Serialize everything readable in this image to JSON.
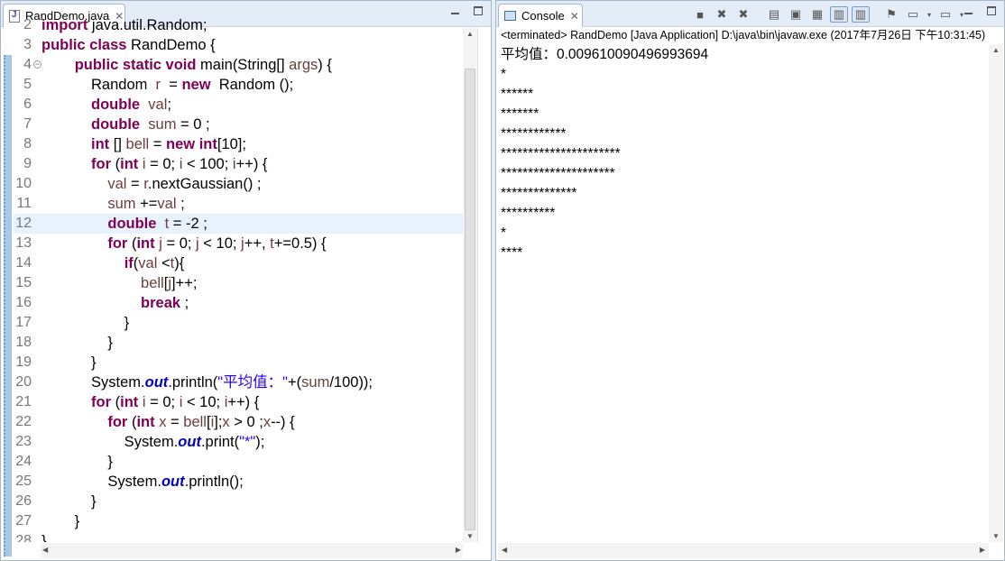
{
  "editor": {
    "tab_title": "RandDemo.java",
    "close_glyph": "✕",
    "lines": [
      {
        "n": "2",
        "html": "<span class=\"kw\">import</span> java.util.Random;"
      },
      {
        "n": "3",
        "html": "<span class=\"kw\">public class</span> RandDemo {"
      },
      {
        "n": "4",
        "html": "        <span class=\"kw\">public static void</span> main(String[] <span class=\"var\">args</span>) {",
        "fold": true
      },
      {
        "n": "5",
        "html": "            Random  <span class=\"var\">r</span>  = <span class=\"kw\">new</span>  Random ();"
      },
      {
        "n": "6",
        "html": "            <span class=\"kw\">double</span>  <span class=\"var\">val</span>;"
      },
      {
        "n": "7",
        "html": "            <span class=\"kw\">double</span>  <span class=\"var\">sum</span> = 0 ;"
      },
      {
        "n": "8",
        "html": "            <span class=\"kw\">int</span> [] <span class=\"var\">bell</span> = <span class=\"kw\">new int</span>[10];"
      },
      {
        "n": "9",
        "html": "            <span class=\"kw\">for</span> (<span class=\"kw\">int</span> <span class=\"var\">i</span> = 0; <span class=\"var\">i</span> &lt; 100; <span class=\"var\">i</span>++) {"
      },
      {
        "n": "10",
        "html": "                <span class=\"var\">val</span> = <span class=\"var\">r</span>.nextGaussian() ;"
      },
      {
        "n": "11",
        "html": "                <span class=\"var\">sum</span> +=<span class=\"var\">val</span> ;"
      },
      {
        "n": "12",
        "html": "                <span class=\"kw\">double</span>  <span class=\"var\">t</span> = -2 ;",
        "current": true
      },
      {
        "n": "13",
        "html": "                <span class=\"kw\">for</span> (<span class=\"kw\">int</span> <span class=\"var\">j</span> = 0; <span class=\"var\">j</span> &lt; 10; <span class=\"var\">j</span>++, <span class=\"var\">t</span>+=0.5) {"
      },
      {
        "n": "14",
        "html": "                    <span class=\"kw\">if</span>(<span class=\"var\">val</span> &lt;<span class=\"var\">t</span>){"
      },
      {
        "n": "15",
        "html": "                        <span class=\"var\">bell</span>[<span class=\"var\">j</span>]++;"
      },
      {
        "n": "16",
        "html": "                        <span class=\"kw\">break</span> ;"
      },
      {
        "n": "17",
        "html": "                    }"
      },
      {
        "n": "18",
        "html": "                }"
      },
      {
        "n": "19",
        "html": "            }"
      },
      {
        "n": "20",
        "html": "            System.<span class=\"fld\">out</span>.println(<span class=\"str\">\"平均值：\"</span>+(<span class=\"var\">sum</span>/100));"
      },
      {
        "n": "21",
        "html": "            <span class=\"kw\">for</span> (<span class=\"kw\">int</span> <span class=\"var\">i</span> = 0; <span class=\"var\">i</span> &lt; 10; <span class=\"var\">i</span>++) {"
      },
      {
        "n": "22",
        "html": "                <span class=\"kw\">for</span> (<span class=\"kw\">int</span> <span class=\"var\">x</span> = <span class=\"var\">bell</span>[<span class=\"var\">i</span>];<span class=\"var\">x</span> &gt; 0 ;<span class=\"var\">x</span>--) {"
      },
      {
        "n": "23",
        "html": "                    System.<span class=\"fld\">out</span>.print(<span class=\"str\">\"*\"</span>);"
      },
      {
        "n": "24",
        "html": "                }"
      },
      {
        "n": "25",
        "html": "                System.<span class=\"fld\">out</span>.println();"
      },
      {
        "n": "26",
        "html": "            }"
      },
      {
        "n": "27",
        "html": "        }"
      },
      {
        "n": "28",
        "html": "}"
      }
    ]
  },
  "console": {
    "tab_title": "Console",
    "close_glyph": "✕",
    "status": "<terminated> RandDemo [Java Application] D:\\java\\bin\\javaw.exe (2017年7月26日 下午10:31:45)",
    "output": [
      "平均值：0.009610090496993694",
      "*",
      "******",
      "*******",
      "************",
      "**********************",
      "*********************",
      "**************",
      "**********",
      "*",
      "****"
    ],
    "toolbar": [
      {
        "name": "terminate-icon",
        "glyph": "■"
      },
      {
        "name": "remove-launch-icon",
        "glyph": "✖"
      },
      {
        "name": "remove-all-icon",
        "glyph": "✖"
      },
      {
        "name": "sep",
        "glyph": ""
      },
      {
        "name": "clear-console-icon",
        "glyph": "▤"
      },
      {
        "name": "scroll-lock-icon",
        "glyph": "▣"
      },
      {
        "name": "word-wrap-icon",
        "glyph": "▦"
      },
      {
        "name": "show-stdout-icon",
        "glyph": "▥",
        "pressed": true
      },
      {
        "name": "show-stderr-icon",
        "glyph": "▥",
        "pressed": true
      },
      {
        "name": "sep",
        "glyph": ""
      },
      {
        "name": "pin-console-icon",
        "glyph": "⚑"
      },
      {
        "name": "display-console-icon",
        "glyph": "▭"
      },
      {
        "name": "dropdown-icon",
        "glyph": "▾",
        "dd": true
      },
      {
        "name": "open-console-icon",
        "glyph": "▭"
      },
      {
        "name": "dropdown-icon",
        "glyph": "▾",
        "dd": true
      }
    ]
  }
}
